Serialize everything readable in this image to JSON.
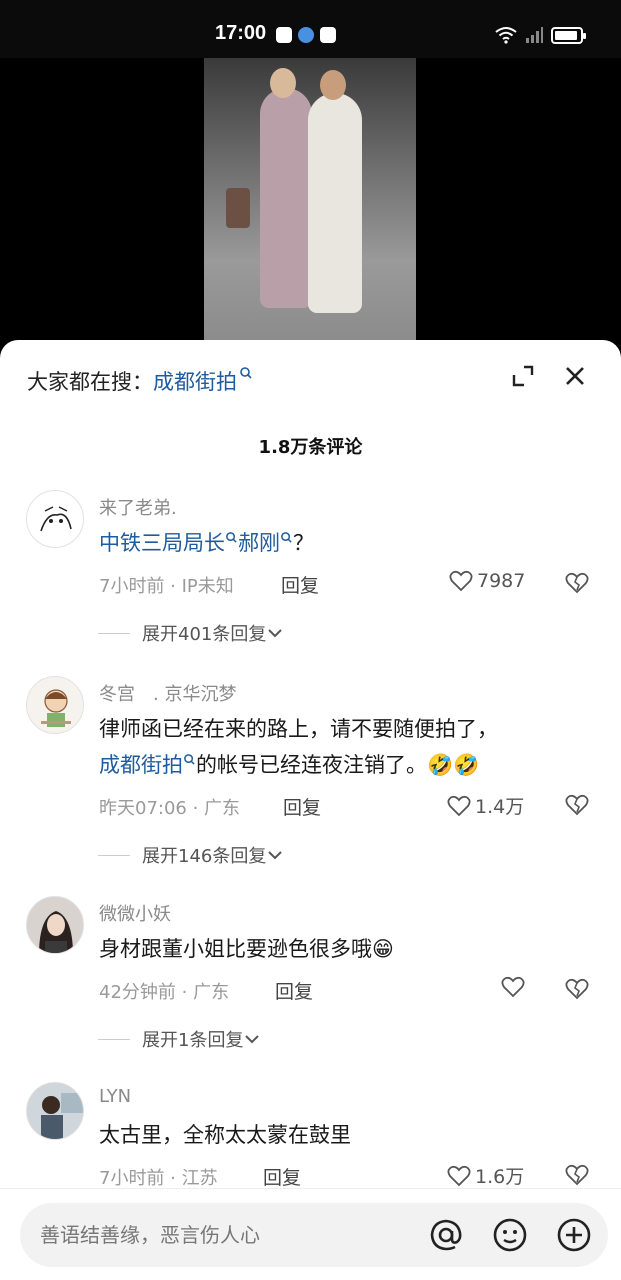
{
  "status": {
    "time": "17:00"
  },
  "search": {
    "prefix": "大家都在搜：",
    "keyword": "成都街拍"
  },
  "comments_count": "1.8万条评论",
  "comments": [
    {
      "name": "来了老弟.",
      "text_parts": [
        "中铁三局局长",
        "郝刚",
        "？"
      ],
      "meta": "7小时前 · IP未知",
      "reply": "回复",
      "likes": "7987",
      "expand": "展开401条回复"
    },
    {
      "name": "冬宫　. 京华沉梦",
      "text_line1": "律师函已经在来的路上，请不要随便拍了，",
      "text_kw": "成都街拍",
      "text_line2_rest": "的帐号已经连夜注销了。🤣🤣",
      "meta": "昨天07:06 · 广东",
      "reply": "回复",
      "likes": "1.4万",
      "expand": "展开146条回复"
    },
    {
      "name": "微微小妖",
      "text": "身材跟董小姐比要逊色很多哦😁",
      "meta": "42分钟前 · 广东",
      "reply": "回复",
      "likes": "",
      "expand": "展开1条回复"
    },
    {
      "name": "LYN",
      "text": "太古里，全称太太蒙在鼓里",
      "meta": "7小时前 · 江苏",
      "reply": "回复",
      "likes": "1.6万"
    }
  ],
  "input": {
    "placeholder": "善语结善缘，恶言伤人心"
  },
  "icons": {
    "search": "search-icon",
    "expand": "expand-icon",
    "close": "close-icon",
    "like": "heart-icon",
    "dislike": "broken-heart-icon",
    "mention": "at-icon",
    "emoji": "emoji-icon",
    "add": "plus-icon"
  },
  "colors": {
    "keyword": "#1f5b9e"
  }
}
